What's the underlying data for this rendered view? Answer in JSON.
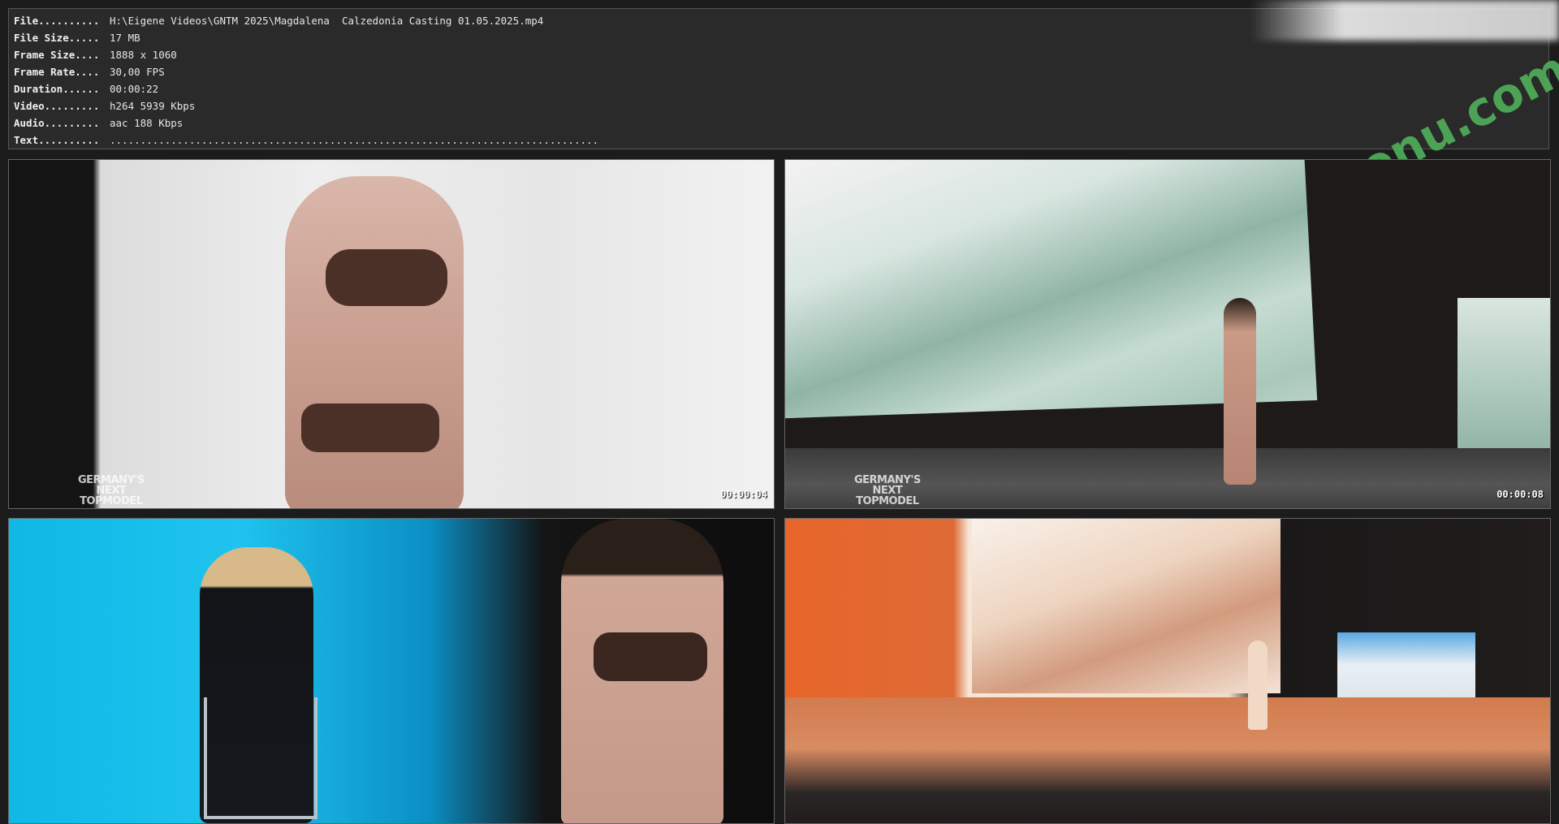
{
  "info": {
    "rows": [
      {
        "label": "File..........",
        "value": "H:\\Eigene Videos\\GNTM 2025\\Magdalena  Calzedonia Casting 01.05.2025.mp4"
      },
      {
        "label": "File Size.....",
        "value": "17 MB"
      },
      {
        "label": "Frame Size....",
        "value": "1888 x 1060"
      },
      {
        "label": "Frame Rate....",
        "value": "30,00 FPS"
      },
      {
        "label": "Duration......",
        "value": "00:00:22"
      },
      {
        "label": "Video.........",
        "value": "h264 5939 Kbps"
      },
      {
        "label": "Audio.........",
        "value": "aac 188 Kbps"
      },
      {
        "label": "Text..........",
        "value": "................................................................................"
      }
    ]
  },
  "thumbnails": [
    {
      "timestamp": "00:00:04",
      "logo_lines": [
        "GERMANY'S",
        "NEXT",
        "TOPMODEL"
      ]
    },
    {
      "timestamp": "00:00:08",
      "logo_lines": [
        "GERMANY'S",
        "NEXT",
        "TOPMODEL"
      ]
    },
    {
      "timestamp": "",
      "logo_lines": []
    },
    {
      "timestamp": "",
      "logo_lines": []
    }
  ],
  "watermark": {
    "text": "fapmenu.com",
    "color": "#4fae5a"
  }
}
